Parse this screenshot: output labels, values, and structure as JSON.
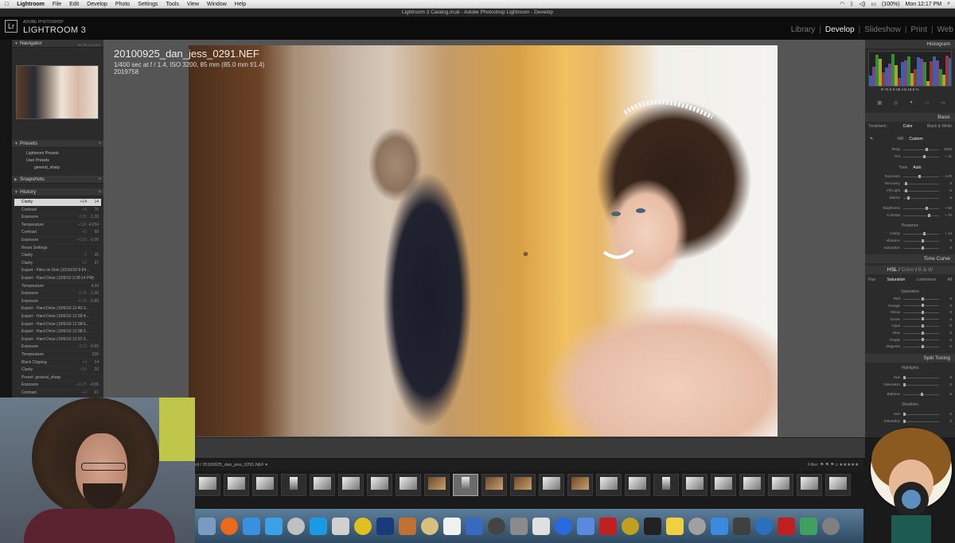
{
  "menubar": {
    "apple": "",
    "items": [
      "Lightroom",
      "File",
      "Edit",
      "Develop",
      "Photo",
      "Settings",
      "Tools",
      "View",
      "Window",
      "Help"
    ],
    "battery": "(100%)",
    "clock": "Mon 12:17 PM"
  },
  "window_title": "Lightroom 3 Catalog.lrcat - Adobe Photoshop Lightroom - Develop",
  "header": {
    "logo": "Lr",
    "product_small": "ADOBE PHOTOSHOP",
    "product": "LIGHTROOM 3",
    "modules": [
      "Library",
      "Develop",
      "Slideshow",
      "Print",
      "Web"
    ],
    "active_module": "Develop"
  },
  "left": {
    "navigator": {
      "title": "Navigator",
      "options": "FIT FILL 1:1 3:1"
    },
    "presets": {
      "title": "Presets",
      "items": [
        "Lightroom Presets",
        "User Presets",
        "general_sharp"
      ]
    },
    "snapshots": {
      "title": "Snapshots"
    },
    "history": {
      "title": "History",
      "items": [
        {
          "label": "Clarity",
          "v1": "+14",
          "v2": "14",
          "selected": true
        },
        {
          "label": "Contrast",
          "v1": "+8",
          "v2": "76"
        },
        {
          "label": "Exposure",
          "v1": "-0.20",
          "v2": "-1.20"
        },
        {
          "label": "Temperature",
          "v1": "+136",
          "v2": "4,634"
        },
        {
          "label": "Contrast",
          "v1": "+2",
          "v2": "68"
        },
        {
          "label": "Exposure",
          "v1": "+0.60",
          "v2": "-1.00"
        },
        {
          "label": "Reset Settings",
          "v1": "",
          "v2": ""
        },
        {
          "label": "Clarity",
          "v1": "-2",
          "v2": "25"
        },
        {
          "label": "Clarity",
          "v1": "+2",
          "v2": "27"
        },
        {
          "label": "Export - Files on Disk (10/10/10 8:54...",
          "v1": "",
          "v2": ""
        },
        {
          "label": "Export - Hard Drive (10/9/10 3:28:14 PM)",
          "v1": "",
          "v2": ""
        },
        {
          "label": "Temperature",
          "v1": "",
          "v2": "4,34"
        },
        {
          "label": "Exposure",
          "v1": "-0.25",
          "v2": "-1.00"
        },
        {
          "label": "Exposure",
          "v1": "-0.25",
          "v2": "-0.80"
        },
        {
          "label": "Export - Hard Drive (10/6/10 12:40:3...",
          "v1": "",
          "v2": ""
        },
        {
          "label": "Export - Hard Drive (10/6/10 12:39:4...",
          "v1": "",
          "v2": ""
        },
        {
          "label": "Export - Hard Drive (10/6/10 12:38:5...",
          "v1": "",
          "v2": ""
        },
        {
          "label": "Export - Hard Drive (10/6/10 12:38:2...",
          "v1": "",
          "v2": ""
        },
        {
          "label": "Export - Hard Drive (10/6/10 12:37:2...",
          "v1": "",
          "v2": ""
        },
        {
          "label": "Exposure",
          "v1": "-0.10",
          "v2": "-0.65"
        },
        {
          "label": "Temperature",
          "v1": "",
          "v2": "236"
        },
        {
          "label": "Black Clipping",
          "v1": "+4",
          "v2": "14"
        },
        {
          "label": "Clarity",
          "v1": "+20",
          "v2": "20"
        },
        {
          "label": "Preset: general_sharp",
          "v1": "",
          "v2": ""
        },
        {
          "label": "Exposure",
          "v1": "+0.15",
          "v2": "-0.55"
        },
        {
          "label": "Contrast",
          "v1": "+4",
          "v2": "61"
        }
      ]
    }
  },
  "photo": {
    "filename": "20100925_dan_jess_0291.NEF",
    "exif": "1/400 sec at f / 1.4, ISO 3200, 85 mm (85.0 mm f/1.4)",
    "number": "2019758"
  },
  "filmstrip": {
    "path": "rd / 20100925_dan_jess_0291.NEF ▾",
    "filter_label": "Filter:",
    "filter_stars": "≥ ★★★★★",
    "selected_index": 9,
    "thumb_count": 23
  },
  "right": {
    "histogram": {
      "title": "Histogram",
      "vals": "R 74.6   G 59.4   B 18.6 %"
    },
    "basic": {
      "title": "Basic",
      "treatment_label": "Treatment :",
      "treatment_options": [
        "Color",
        "Black & White"
      ],
      "wb_label": "WB :",
      "wb_value": "Custom",
      "sliders1": [
        {
          "label": "Temp",
          "value": "4634",
          "pos": 0.62
        },
        {
          "label": "Tint",
          "value": "+ 11",
          "pos": 0.55
        }
      ],
      "tone_label": "Tone",
      "auto_label": "Auto",
      "sliders2": [
        {
          "label": "Exposure",
          "value": "- 1.20",
          "pos": 0.42
        },
        {
          "label": "Recovery",
          "value": "0",
          "pos": 0.05
        },
        {
          "label": "Fill Light",
          "value": "0",
          "pos": 0.05
        },
        {
          "label": "Blacks",
          "value": "5",
          "pos": 0.1
        }
      ],
      "sliders3": [
        {
          "label": "Brightness",
          "value": "+ 50",
          "pos": 0.62
        },
        {
          "label": "Contrast",
          "value": "+ 76",
          "pos": 0.68
        }
      ],
      "presence_label": "Presence",
      "sliders4": [
        {
          "label": "Clarity",
          "value": "+ 14",
          "pos": 0.56
        },
        {
          "label": "Vibrance",
          "value": "0",
          "pos": 0.5
        },
        {
          "label": "Saturation",
          "value": "0",
          "pos": 0.5
        }
      ]
    },
    "tone_curve": {
      "title": "Tone Curve"
    },
    "hsl": {
      "tabs": [
        "HSL",
        "Color",
        "B & W"
      ],
      "sub_tabs": [
        "Hue",
        "Saturation",
        "Luminance",
        "All"
      ],
      "section": "Saturation",
      "sliders": [
        {
          "label": "Red",
          "value": "0"
        },
        {
          "label": "Orange",
          "value": "0"
        },
        {
          "label": "Yellow",
          "value": "0"
        },
        {
          "label": "Green",
          "value": "0"
        },
        {
          "label": "Aqua",
          "value": "0"
        },
        {
          "label": "Blue",
          "value": "0"
        },
        {
          "label": "Purple",
          "value": "0"
        },
        {
          "label": "Magenta",
          "value": "0"
        }
      ]
    },
    "split_toning": {
      "title": "Split Toning",
      "highlights": "Highlights",
      "shadows": "Shadows",
      "balance": "Balance",
      "hue": "Hue",
      "saturation": "Saturation",
      "values": [
        "0",
        "0",
        "0",
        "0",
        "0"
      ]
    }
  },
  "dock_icons": [
    "finder",
    "firefox",
    "chrome",
    "itunes",
    "compass",
    "skype",
    "x",
    "twitter",
    "photoshop",
    "guitar",
    "notes",
    "ical",
    "preview",
    "camera",
    "photo",
    "iphoto",
    "flickr",
    "upload",
    "pdf",
    "pineapple",
    "terminal",
    "stickies",
    "tools",
    "safari",
    "disk",
    "dropbox",
    "filezilla",
    "migration",
    "settings"
  ],
  "colors": {
    "accent": "#e3e3e3",
    "panel": "#2b2b2b",
    "header": "#0c0c0c"
  }
}
